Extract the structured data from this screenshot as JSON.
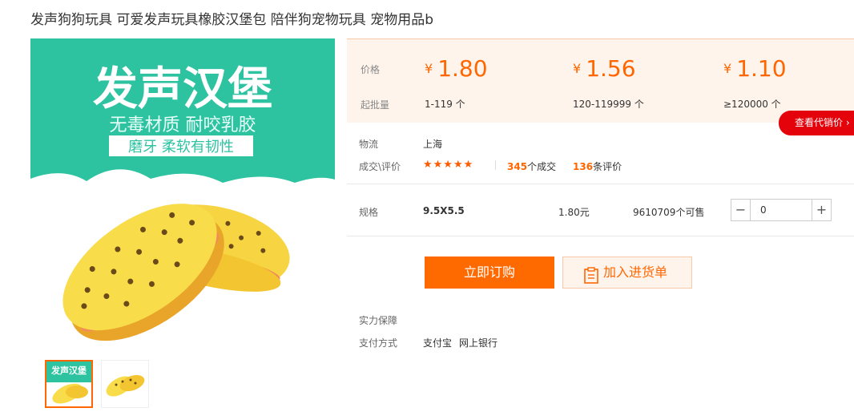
{
  "product": {
    "title": "发声狗狗玩具 可爱发声玩具橡胶汉堡包 陪伴狗宠物玩具 宠物用品b"
  },
  "main_image": {
    "headline": "发声汉堡",
    "subline": "无毒材质 耐咬乳胶",
    "tag": "磨牙 柔软有韧性"
  },
  "thumb_image": {
    "headline": "发声汉堡"
  },
  "pricing": {
    "price_label": "价格",
    "moq_label": "起批量",
    "currency": "¥",
    "tiers": [
      {
        "price": "1.80",
        "range": "1-119 个"
      },
      {
        "price": "1.56",
        "range": "120-119999 个"
      },
      {
        "price": "1.10",
        "range": "≥120000 个"
      }
    ],
    "agent_button": "查看代销价"
  },
  "logistics": {
    "label": "物流",
    "value": "上海"
  },
  "deals": {
    "label": "成交\\评价",
    "rating": 4.5,
    "stars_text": "★★★★★",
    "deal_count": "345",
    "deal_suffix": "个成交",
    "review_count": "136",
    "review_suffix": "条评价"
  },
  "spec": {
    "label": "规格",
    "name": "9.5X5.5",
    "price": "1.80元",
    "stock": "9610709个可售",
    "quantity": "0",
    "minus": "−",
    "plus": "+"
  },
  "actions": {
    "buy": "立即订购",
    "add_to_list": "加入进货单"
  },
  "guarantee": {
    "label": "实力保障"
  },
  "payment": {
    "label": "支付方式",
    "methods": [
      "支付宝",
      "网上银行"
    ]
  },
  "colors": {
    "accent": "#ff6a00",
    "teal": "#2dc3a1",
    "red": "#e4020b"
  }
}
